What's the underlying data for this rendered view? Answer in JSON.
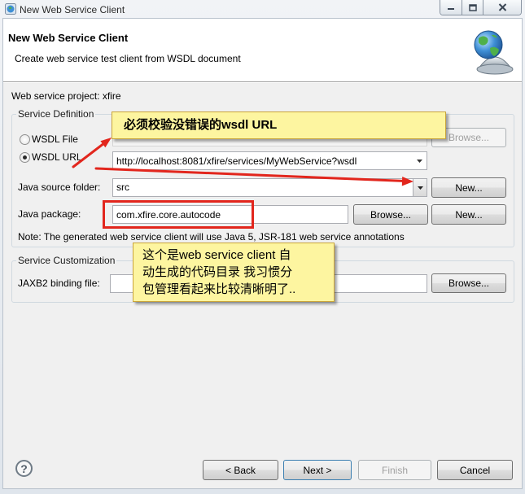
{
  "colors": {
    "callout_fill": "#fdf5a0",
    "callout_border": "#c9a43a",
    "annotation_red": "#e2261d",
    "header_bg": "#ffffff",
    "body_bg": "#f0f0f0"
  },
  "window": {
    "title": "New Web Service Client",
    "icon": "app-window-icon",
    "controls": {
      "minimize_icon": "minimize-icon",
      "maximize_icon": "maximize-icon",
      "close_icon": "close-icon"
    }
  },
  "header": {
    "title": "New Web Service Client",
    "description": "Create web service test client from WSDL document",
    "icon": "web-service-globe-icon"
  },
  "project": {
    "label": "Web service project: xfire"
  },
  "service_definition": {
    "legend": "Service Definition",
    "wsdl_file": {
      "label": "WSDL File",
      "selected": false,
      "browse_label": "Browse...",
      "browse_enabled": false
    },
    "wsdl_url": {
      "label": "WSDL URL",
      "selected": true,
      "value": "http://localhost:8081/xfire/services/MyWebService?wsdl",
      "dropdown_icon": "chevron-down-icon"
    },
    "source_folder": {
      "label": "Java source folder:",
      "value": "src",
      "new_label": "New...",
      "dropdown_icon": "chevron-down-icon"
    },
    "java_package": {
      "label": "Java package:",
      "value": "com.xfire.core.autocode",
      "browse_label": "Browse...",
      "new_label": "New..."
    },
    "note": "Note: The generated web service client will use Java 5, JSR-181 web service annotations"
  },
  "service_customization": {
    "legend": "Service Customization",
    "binding_label": "JAXB2 binding file:",
    "browse_label": "Browse..."
  },
  "footer": {
    "help_icon": "help-icon",
    "help_glyph": "?",
    "back_label": "< Back",
    "next_label": "Next >",
    "finish_label": "Finish",
    "finish_enabled": false,
    "cancel_label": "Cancel"
  },
  "annotations": {
    "wsdl_callout": "必须校验没错误的wsdl URL",
    "package_callout_lines": [
      "这个是web service client 自",
      "动生成的代码目录 我习惯分",
      "包管理看起来比较清晰明了.."
    ]
  }
}
